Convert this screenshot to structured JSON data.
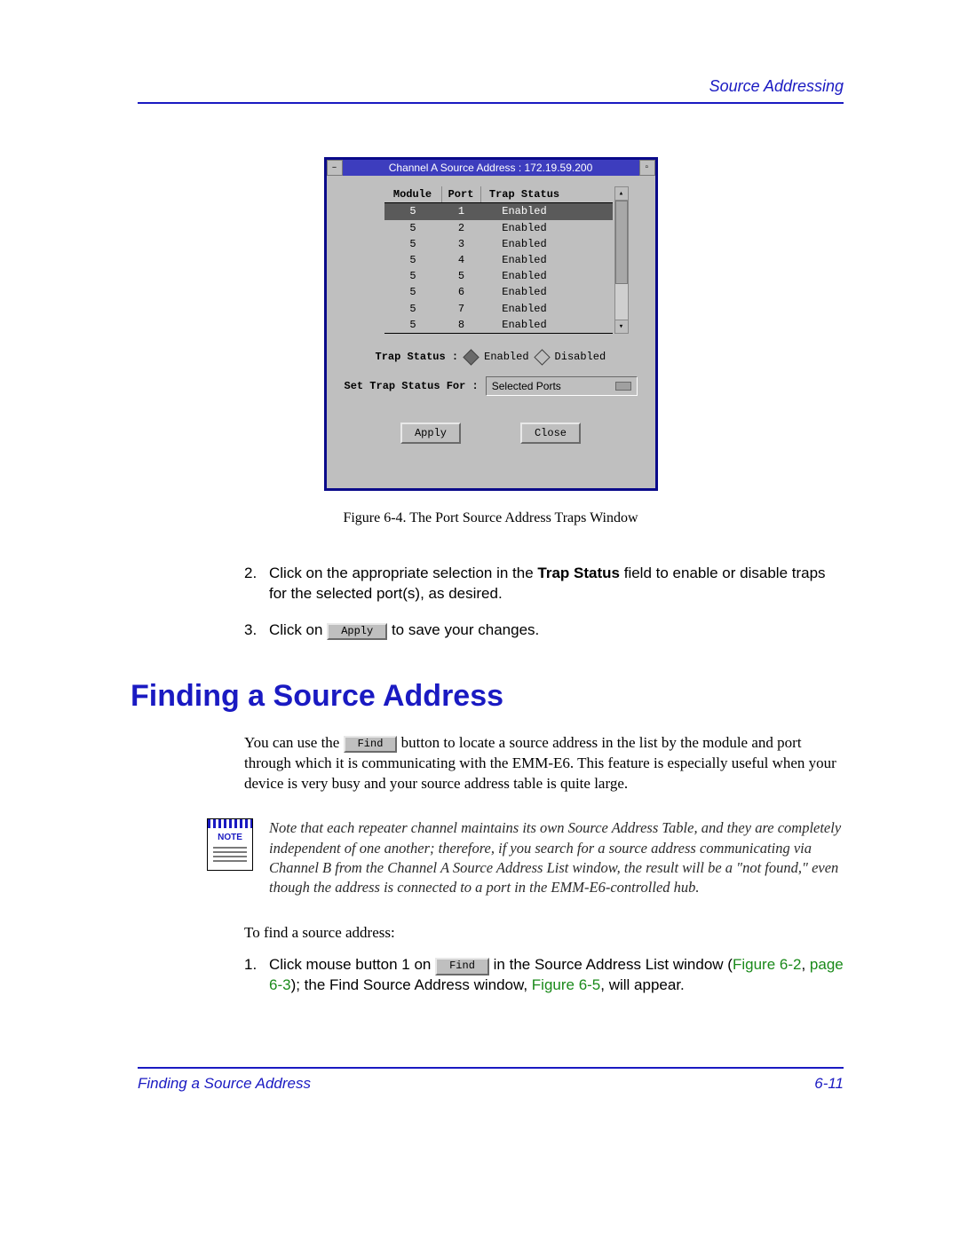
{
  "header": {
    "right": "Source Addressing"
  },
  "window": {
    "title": "Channel A Source Address : 172.19.59.200",
    "menu_glyph": "–",
    "resize_glyph": "▫",
    "columns": {
      "c1": "Module",
      "c2": "Port",
      "c3": "Trap Status"
    },
    "rows": [
      {
        "module": "5",
        "port": "1",
        "status": "Enabled",
        "highlight": true
      },
      {
        "module": "5",
        "port": "2",
        "status": "Enabled",
        "highlight": false
      },
      {
        "module": "5",
        "port": "3",
        "status": "Enabled",
        "highlight": false
      },
      {
        "module": "5",
        "port": "4",
        "status": "Enabled",
        "highlight": false
      },
      {
        "module": "5",
        "port": "5",
        "status": "Enabled",
        "highlight": false
      },
      {
        "module": "5",
        "port": "6",
        "status": "Enabled",
        "highlight": false
      },
      {
        "module": "5",
        "port": "7",
        "status": "Enabled",
        "highlight": false
      },
      {
        "module": "5",
        "port": "8",
        "status": "Enabled",
        "highlight": false
      }
    ],
    "trap_status_label": "Trap Status :",
    "radio_enabled": "Enabled",
    "radio_disabled": "Disabled",
    "set_label": "Set Trap Status For :",
    "set_value": "Selected Ports",
    "apply": "Apply",
    "close": "Close"
  },
  "caption": "Figure 6-4. The Port Source Address Traps Window",
  "step2": {
    "num": "2.",
    "a": "Click on the appropriate selection in the ",
    "bold": "Trap Status",
    "b": " field to enable or disable traps for the selected port(s), as desired."
  },
  "step3": {
    "num": "3.",
    "a": "Click on ",
    "btn": "Apply",
    "b": " to save your changes."
  },
  "section_title": "Finding a Source Address",
  "para1": {
    "a": "You can use the ",
    "btn": "Find",
    "b": " button to locate a source address in the list by the module and port through which it is communicating with the EMM-E6. This feature is especially useful when your device is very busy and your source address table is quite large."
  },
  "note": {
    "label": "NOTE",
    "text": "Note that each repeater channel maintains its own Source Address Table, and they are completely independent of one another; therefore, if you search for a source address communicating via Channel B from the Channel A Source Address List window, the result will be a \"not found,\" even though the address is connected to a port in the EMM-E6-controlled hub."
  },
  "intro": "To find a source address:",
  "step1": {
    "num": "1.",
    "a": "Click mouse button 1 on ",
    "btn": "Find",
    "b": " in the Source Address List window (",
    "link1": "Figure 6-2",
    "c": ", ",
    "link2": "page 6-3",
    "d": "); the Find Source Address window, ",
    "link3": "Figure 6-5",
    "e": ", will appear."
  },
  "footer": {
    "left": "Finding a Source Address",
    "right": "6-11"
  }
}
